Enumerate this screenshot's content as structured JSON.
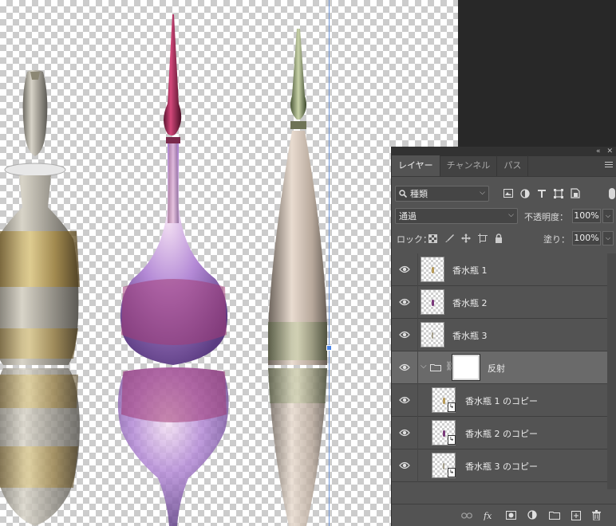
{
  "panel": {
    "tabs": [
      {
        "label": "レイヤー"
      },
      {
        "label": "チャンネル"
      },
      {
        "label": "パス"
      }
    ],
    "filter": {
      "kind_label": "種類"
    },
    "blend_mode": "通過",
    "opacity_label": "不透明度：",
    "opacity_value": "100%",
    "lock_label": "ロック：",
    "fill_label": "塗り：",
    "fill_value": "100%",
    "layers": [
      {
        "name": "香水瓶 1"
      },
      {
        "name": "香水瓶 2"
      },
      {
        "name": "香水瓶 3"
      },
      {
        "name": "反射"
      },
      {
        "name": "香水瓶 1 のコピー"
      },
      {
        "name": "香水瓶 2 のコピー"
      },
      {
        "name": "香水瓶 3 のコピー"
      }
    ],
    "bottom_icons": [
      "link-icon",
      "fx-icon",
      "add-mask-icon",
      "adjustment-icon",
      "new-group-icon",
      "new-layer-icon",
      "trash-icon"
    ]
  },
  "colors": {
    "panel_bg": "#535353",
    "selected_row": "#6a6a6a",
    "guide": "#6f96d8"
  }
}
